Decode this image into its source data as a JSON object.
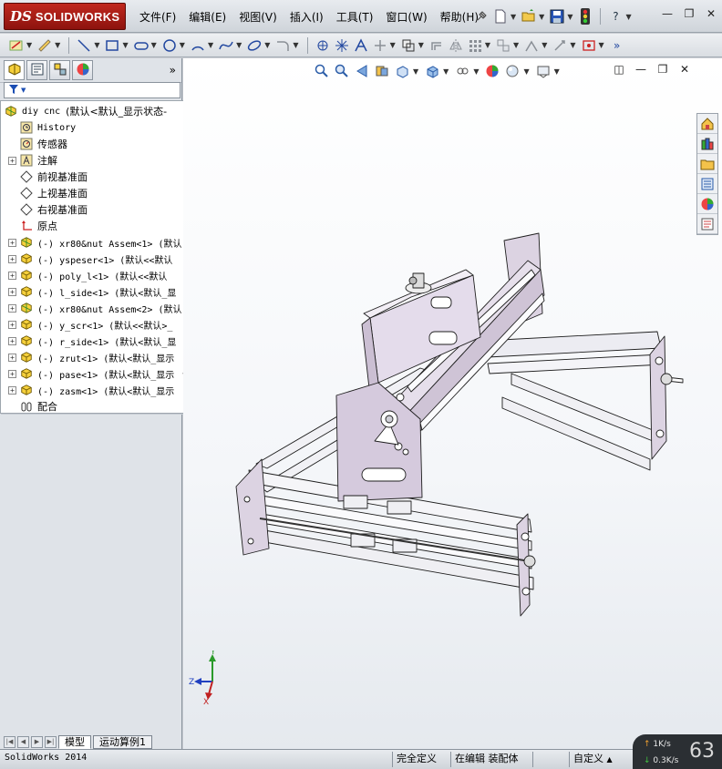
{
  "app": {
    "logo_mark": "DS",
    "logo_text": "SOLIDWORKS",
    "status_name": "SolidWorks 2014"
  },
  "menu": [
    "文件(F)",
    "编辑(E)",
    "视图(V)",
    "插入(I)",
    "工具(T)",
    "窗口(W)",
    "帮助(H)"
  ],
  "title_tools": {
    "pin": "pin-icon",
    "new": "new-document-icon",
    "open": "open-folder-icon",
    "save": "save-icon",
    "rebuild": "traffic-light-icon",
    "help": "?"
  },
  "window_controls": {
    "minimize": "—",
    "restore": "❐",
    "close": "✕"
  },
  "feature_tree": {
    "root": {
      "name": "diy cnc",
      "config": "(默认<默认_显示状态-"
    },
    "items": [
      {
        "label": "History",
        "icon": "history-icon",
        "mono": true,
        "expand": false
      },
      {
        "label": "传感器",
        "icon": "sensor-icon",
        "mono": false,
        "expand": false
      },
      {
        "label": "注解",
        "icon": "annotation-icon",
        "mono": false,
        "expand": true
      },
      {
        "label": "前视基准面",
        "icon": "plane-icon",
        "mono": false,
        "expand": false
      },
      {
        "label": "上视基准面",
        "icon": "plane-icon",
        "mono": false,
        "expand": false
      },
      {
        "label": "右视基准面",
        "icon": "plane-icon",
        "mono": false,
        "expand": false
      },
      {
        "label": "原点",
        "icon": "origin-icon",
        "mono": false,
        "expand": false
      },
      {
        "label": "(-) xr80&nut Assem<1> (默认",
        "icon": "assembly-icon",
        "mono": true,
        "expand": true
      },
      {
        "label": "(-) yspeser<1> (默认<<默认",
        "icon": "part-icon",
        "mono": true,
        "expand": true
      },
      {
        "label": "(-) poly_l<1> (默认<<默认",
        "icon": "part-icon",
        "mono": true,
        "expand": true
      },
      {
        "label": "(-) l_side<1> (默认<默认_显",
        "icon": "part-icon",
        "mono": true,
        "expand": true
      },
      {
        "label": "(-) xr80&nut Assem<2> (默认",
        "icon": "assembly-icon",
        "mono": true,
        "expand": true
      },
      {
        "label": "(-) y_scr<1> (默认<<默认>_",
        "icon": "part-icon",
        "mono": true,
        "expand": true
      },
      {
        "label": "(-) r_side<1> (默认<默认_显",
        "icon": "part-icon",
        "mono": true,
        "expand": true
      },
      {
        "label": "(-) zrut<1> (默认<默认_显示",
        "icon": "part-icon",
        "mono": true,
        "expand": true
      },
      {
        "label": "(-) pase<1> (默认<默认_显示",
        "icon": "part-icon",
        "mono": true,
        "expand": true
      },
      {
        "label": "(-) zasm<1> (默认<默认_显示",
        "icon": "part-icon",
        "mono": true,
        "expand": true
      },
      {
        "label": "配合",
        "icon": "mates-icon",
        "mono": false,
        "expand": false
      }
    ]
  },
  "bottom_tabs": [
    "模型",
    "运动算例1"
  ],
  "status": {
    "cells": [
      "完全定义",
      "在编辑 装配体",
      "自定义"
    ]
  },
  "network": {
    "up": "1K/s",
    "down": "0.3K/s",
    "percent": "63"
  },
  "triad": {
    "x": "X",
    "y": "Y",
    "z": "Z"
  },
  "colors": {
    "accent": "#2348a0",
    "brand_red": "#b01f17",
    "model_plate": "#d7cddd",
    "model_edge": "#222222"
  }
}
